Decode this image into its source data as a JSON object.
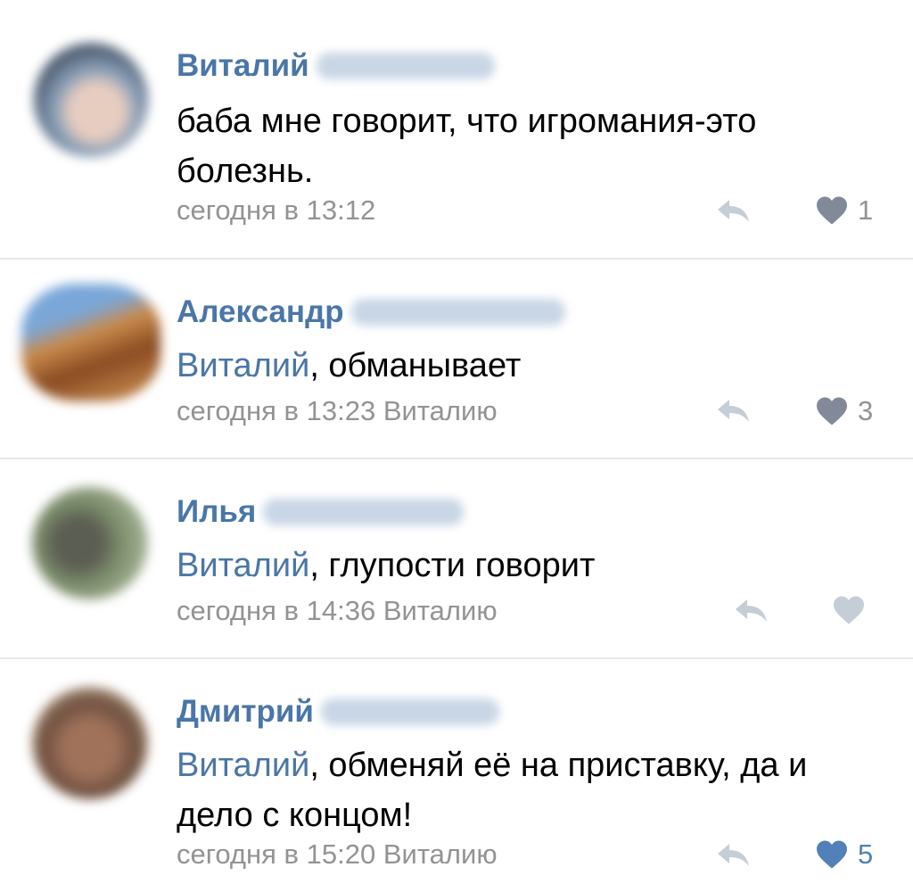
{
  "comments": [
    {
      "author": "Виталий",
      "mention": "",
      "text": "баба мне говорит, что игромания-это болезнь.",
      "time": "сегодня в 13:12",
      "reply_to": "",
      "likes": "1",
      "liked": false
    },
    {
      "author": "Александр",
      "mention": "Виталий",
      "text": ", обманывает",
      "time": "сегодня в 13:23",
      "reply_to": "Виталию",
      "likes": "3",
      "liked": false
    },
    {
      "author": "Илья",
      "mention": "Виталий",
      "text": ", глупости говорит",
      "time": "сегодня в 14:36",
      "reply_to": "Виталию",
      "likes": "",
      "liked": false
    },
    {
      "author": "Дмитрий",
      "mention": "Виталий",
      "text": ", обменяй её на приставку, да и дело с концом!",
      "time": "сегодня в 15:20",
      "reply_to": "Виталию",
      "likes": "5",
      "liked": true
    }
  ],
  "colors": {
    "link": "#4a76a8",
    "meta": "#939393",
    "icon": "#c5cdd6",
    "heart_default": "#828a99",
    "heart_liked": "#5181b8",
    "heart_empty": "#c5cdd6",
    "divider": "#e7e8ec"
  },
  "icons": {
    "reply": "reply-arrow-icon",
    "like": "heart-icon"
  }
}
